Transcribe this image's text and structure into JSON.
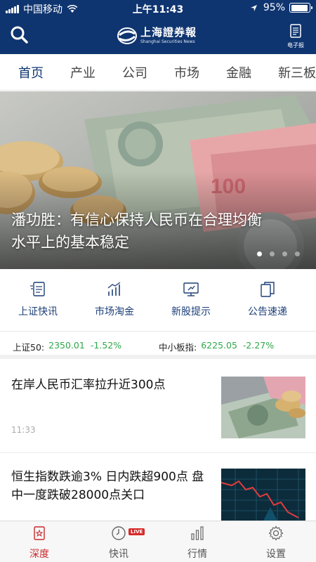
{
  "status_bar": {
    "carrier": "中国移动",
    "time": "上午11:43",
    "battery_percent": "95%",
    "battery_level": 0.95
  },
  "header": {
    "logo_cn": "上海證券報",
    "logo_en": "Shanghai Securities News",
    "epaper_label": "电子报",
    "background_color": "#0f3570"
  },
  "tabs": [
    {
      "label": "首页",
      "active": true
    },
    {
      "label": "产业"
    },
    {
      "label": "公司"
    },
    {
      "label": "市场"
    },
    {
      "label": "金融"
    },
    {
      "label": "新三板"
    }
  ],
  "banner": {
    "title": "潘功胜：有信心保持人民币在合理均衡水平上的基本稳定",
    "slide_count": 4,
    "active_slide": 1
  },
  "quick_links": [
    {
      "label": "上证快讯",
      "icon": "news-flash-icon"
    },
    {
      "label": "市场淘金",
      "icon": "market-chart-icon"
    },
    {
      "label": "新股提示",
      "icon": "ipo-monitor-icon"
    },
    {
      "label": "公告速递",
      "icon": "announcement-copy-icon"
    }
  ],
  "tickers": [
    {
      "name": "上证50:",
      "value": "2350.01",
      "change": "-1.52%"
    },
    {
      "name": "中小板指:",
      "value": "6225.05",
      "change": "-2.27%"
    }
  ],
  "ticker_color": "#2ea84a",
  "news": [
    {
      "title": "在岸人民币汇率拉升近300点",
      "time": "11:33"
    },
    {
      "title": "恒生指数跌逾3% 日内跌超900点 盘中一度跌破28000点关口",
      "time": ""
    }
  ],
  "bottom_nav": [
    {
      "label": "深度",
      "icon": "depth-star-icon",
      "active": true
    },
    {
      "label": "快讯",
      "icon": "clock-icon",
      "badge": "LIVE"
    },
    {
      "label": "行情",
      "icon": "bar-chart-icon"
    },
    {
      "label": "设置",
      "icon": "gear-icon"
    }
  ],
  "accent_color": "#c8282c"
}
